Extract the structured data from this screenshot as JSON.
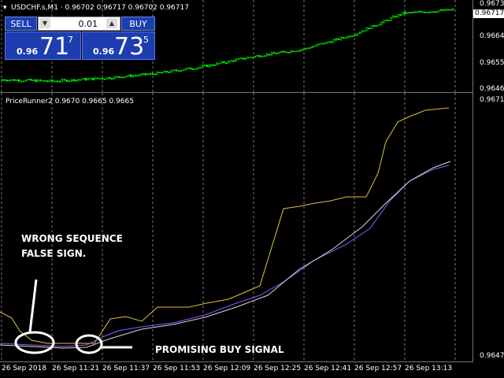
{
  "chart_title": "USDCHF.s,M1 · 0.96702 0.96717 0.96702 0.96717",
  "indicator_title": "PriceRunner2 0.9670 0.9665 0.9665",
  "trade_panel": {
    "sell_label": "SELL",
    "buy_label": "BUY",
    "lot": "0.01",
    "sell_prefix": "0.96",
    "sell_big": "71",
    "sell_sup": "7",
    "buy_prefix": "0.96",
    "buy_big": "73",
    "buy_sup": "5"
  },
  "price_axis": {
    "main_labels": [
      "0.96730",
      "0.96640",
      "0.96550",
      "0.96460"
    ],
    "current_price": "0.96717",
    "indicator_labels": [
      "0.9671",
      "0.9647"
    ]
  },
  "time_axis": [
    "26 Sep 2018",
    "26 Sep 11:21",
    "26 Sep 11:37",
    "26 Sep 11:53",
    "26 Sep 12:09",
    "26 Sep 12:25",
    "26 Sep 12:41",
    "26 Sep 12:57",
    "26 Sep 13:13"
  ],
  "annotations": {
    "wrong_line1": "WRONG SEQUENCE",
    "wrong_line2": "FALSE SIGN.",
    "promising": "PROMISING BUY SIGNAL"
  },
  "colors": {
    "candle": "#00ff00",
    "yellow_line": "#e0c040",
    "purple_line": "#8a5cff",
    "white_line": "#d8d8d8",
    "grid": "#7a7a7a",
    "panel_blue": "#1d3db0"
  },
  "chart_data": {
    "type": "line",
    "x": [
      0,
      10,
      20,
      30,
      40,
      50,
      60,
      70,
      80,
      90
    ],
    "series": [
      {
        "values": [
          0.96475,
          0.9647,
          0.9648,
          0.96495,
          0.9652,
          0.96555,
          0.9658,
          0.9663,
          0.96705,
          0.96717
        ]
      }
    ]
  }
}
